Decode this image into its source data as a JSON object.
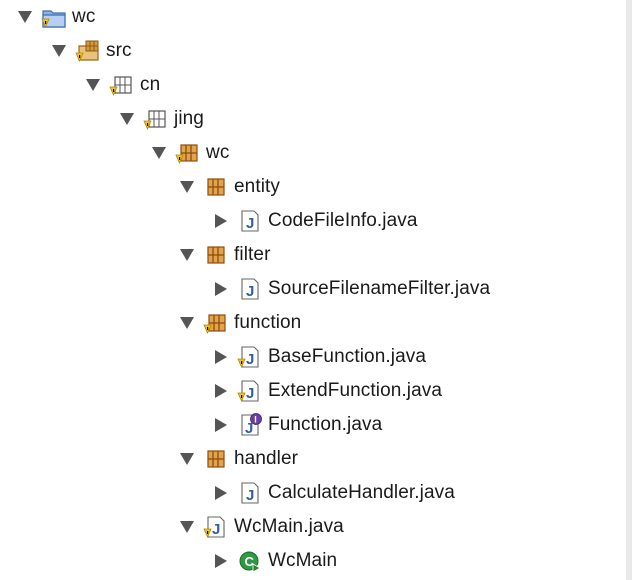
{
  "tree": {
    "nodes": [
      {
        "label": "wc",
        "type": "project",
        "expanded": true,
        "warning": true
      },
      {
        "label": "src",
        "type": "source-folder",
        "expanded": true,
        "warning": true
      },
      {
        "label": "cn",
        "type": "package-empty",
        "expanded": true,
        "warning": true
      },
      {
        "label": "jing",
        "type": "package-empty",
        "expanded": true,
        "warning": true
      },
      {
        "label": "wc",
        "type": "package",
        "expanded": true,
        "warning": true
      },
      {
        "label": "entity",
        "type": "package",
        "expanded": true,
        "warning": false
      },
      {
        "label": "CodeFileInfo.java",
        "type": "java-file",
        "expanded": false,
        "warning": false
      },
      {
        "label": "filter",
        "type": "package",
        "expanded": true,
        "warning": false
      },
      {
        "label": "SourceFilenameFilter.java",
        "type": "java-file",
        "expanded": false,
        "warning": false
      },
      {
        "label": "function",
        "type": "package",
        "expanded": true,
        "warning": true
      },
      {
        "label": "BaseFunction.java",
        "type": "java-file",
        "expanded": false,
        "warning": true
      },
      {
        "label": "ExtendFunction.java",
        "type": "java-file",
        "expanded": false,
        "warning": true
      },
      {
        "label": "Function.java",
        "type": "java-interface",
        "expanded": false,
        "warning": false
      },
      {
        "label": "handler",
        "type": "package",
        "expanded": true,
        "warning": false
      },
      {
        "label": "CalculateHandler.java",
        "type": "java-file",
        "expanded": false,
        "warning": false
      },
      {
        "label": "WcMain.java",
        "type": "java-file",
        "expanded": true,
        "warning": true
      },
      {
        "label": "WcMain",
        "type": "class",
        "expanded": false,
        "warning": false
      }
    ]
  },
  "colors": {
    "package": "#b5722a",
    "java_blue": "#2f5f9e",
    "warning": "#e8b800",
    "class_green": "#2e9a45",
    "twisty": "#555555"
  }
}
